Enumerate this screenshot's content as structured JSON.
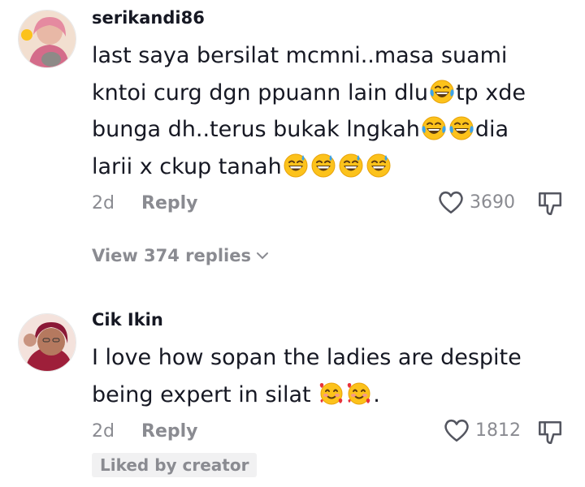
{
  "comments": [
    {
      "username": "serikandi86",
      "lines": [
        [
          "last saya bersilat mcmni..masa suami"
        ],
        [
          "kntoi curg dgn ppuann lain dlu",
          "tp xde"
        ],
        [
          "bunga dh..terus bukak lngkah",
          "",
          "dia"
        ],
        [
          "larii x ckup tanah"
        ]
      ],
      "emoji_icons": [
        "face-with-tears-of-joy-emoji",
        "grinning-sweat-emoji"
      ],
      "time": "2d",
      "reply_label": "Reply",
      "like_count": "3690",
      "view_replies_label": "View 374 replies"
    },
    {
      "username": "Cik Ikin",
      "lines": [
        [
          "I love how sopan the ladies are despite"
        ],
        [
          "being expert in silat",
          "."
        ]
      ],
      "emoji_icons": [
        "smiling-face-with-hearts-emoji"
      ],
      "time": "2d",
      "reply_label": "Reply",
      "like_count": "1812",
      "liked_badge": "Liked by creator"
    }
  ],
  "colors": {
    "text": "#161823",
    "muted": "#8a8b91",
    "badge_bg": "#f1f1f2",
    "emoji_yellow": "#fcc21b",
    "tear_blue": "#3ba3ea",
    "heart_red": "#e8323a"
  }
}
